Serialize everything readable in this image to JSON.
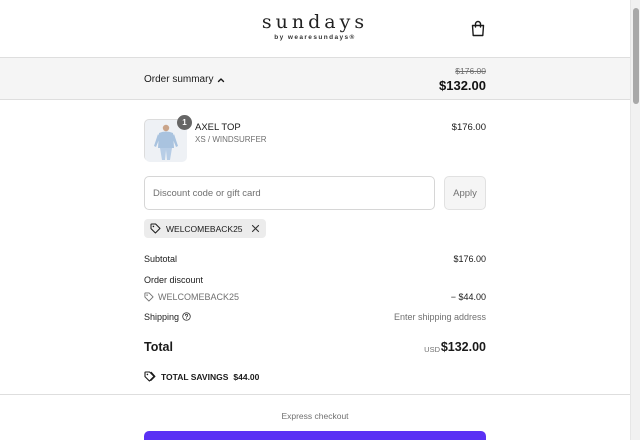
{
  "brand": {
    "wordmark": "sundays",
    "tagline": "by wearesundays®"
  },
  "icons": {
    "bag": "shopping-bag-icon",
    "chevron": "chevron-up-icon",
    "tag": "tag-icon",
    "close": "close-icon",
    "help": "help-circle-icon"
  },
  "summary": {
    "toggle_label": "Order summary",
    "original_total": "$176.00",
    "total": "$132.00"
  },
  "product": {
    "quantity": "1",
    "name": "AXEL TOP",
    "variant": "XS / WINDSURFER",
    "price": "$176.00"
  },
  "discount": {
    "placeholder": "Discount code or gift card",
    "apply_label": "Apply",
    "applied_code": "WELCOMEBACK25"
  },
  "lines": {
    "subtotal_label": "Subtotal",
    "subtotal_value": "$176.00",
    "order_discount_label": "Order discount",
    "order_discount_code": "WELCOMEBACK25",
    "order_discount_value": "− $44.00",
    "shipping_label": "Shipping",
    "shipping_value": "Enter shipping address"
  },
  "total": {
    "label": "Total",
    "currency": "USD",
    "value": "$132.00"
  },
  "savings": {
    "label": "TOTAL SAVINGS",
    "value": "$44.00"
  },
  "checkout": {
    "express_label": "Express checkout"
  },
  "colors": {
    "accent": "#5a31f4",
    "summary_bg": "#f5f5f5",
    "muted_text": "#707070"
  }
}
